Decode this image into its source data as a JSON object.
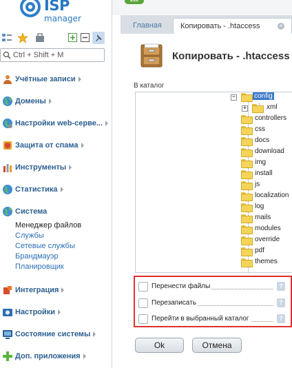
{
  "app": {
    "logo_isp": "ISP",
    "logo_manager": "manager",
    "notification_badge": "210"
  },
  "sidebar": {
    "search_placeholder": "Ctrl + Shift + M",
    "nav": [
      {
        "label": "Учётные записи",
        "icon": "users-icon"
      },
      {
        "label": "Домены",
        "icon": "globe-icon"
      },
      {
        "label": "Настройки web-серве...",
        "icon": "globe-gear-icon"
      },
      {
        "label": "Защита от спама",
        "icon": "shield-icon"
      },
      {
        "label": "Инструменты",
        "icon": "tools-icon"
      },
      {
        "label": "Статистика",
        "icon": "chart-globe-icon"
      },
      {
        "label": "Система",
        "icon": "system-globe-icon"
      },
      {
        "label": "Интеграция",
        "icon": "puzzle-icon"
      },
      {
        "label": "Настройки",
        "icon": "gear-icon"
      },
      {
        "label": "Состояние системы",
        "icon": "monitor-icon"
      },
      {
        "label": "Доп. приложения",
        "icon": "plus-icon"
      }
    ],
    "system_subitems": [
      {
        "label": "Менеджер файлов",
        "active": true
      },
      {
        "label": "Службы",
        "active": false
      },
      {
        "label": "Сетевые службы",
        "active": false
      },
      {
        "label": "Брандмауэр",
        "active": false
      },
      {
        "label": "Планировщик",
        "active": false
      }
    ]
  },
  "tabs": {
    "home": "Главная",
    "current": "Копировать - .htaccess",
    "close": "×"
  },
  "form": {
    "title": "Копировать - .htaccess",
    "directory_label": "В каталог",
    "tree": [
      {
        "name": "config",
        "expander": "−",
        "selected": true
      },
      {
        "name": "xml",
        "expander": "+",
        "selected": false
      },
      {
        "name": "controllers",
        "expander": "+",
        "selected": false
      },
      {
        "name": "css",
        "expander": "",
        "selected": false
      },
      {
        "name": "docs",
        "expander": "+",
        "selected": false
      },
      {
        "name": "download",
        "expander": "",
        "selected": false
      },
      {
        "name": "img",
        "expander": "+",
        "selected": false
      },
      {
        "name": "install",
        "expander": "+",
        "selected": false
      },
      {
        "name": "js",
        "expander": "+",
        "selected": false
      },
      {
        "name": "localization",
        "expander": "",
        "selected": false
      },
      {
        "name": "log",
        "expander": "",
        "selected": false
      },
      {
        "name": "mails",
        "expander": "+",
        "selected": false
      },
      {
        "name": "modules",
        "expander": "+",
        "selected": false
      },
      {
        "name": "override",
        "expander": "+",
        "selected": false
      },
      {
        "name": "pdf",
        "expander": "",
        "selected": false
      },
      {
        "name": "themes",
        "expander": "+",
        "selected": false
      }
    ],
    "options": [
      {
        "label": "Перенести файлы",
        "checked": false,
        "help": "?"
      },
      {
        "label": "Перезаписать",
        "checked": false,
        "help": "?"
      },
      {
        "label": "Перейти в выбранный каталог",
        "checked": false,
        "help": "?"
      }
    ],
    "ok_label": "Ok",
    "cancel_label": "Отмена"
  },
  "colors": {
    "link": "#2c5f91",
    "highlight": "#e0302c",
    "selection": "#3a78c9",
    "folder": "#f4d55a"
  }
}
